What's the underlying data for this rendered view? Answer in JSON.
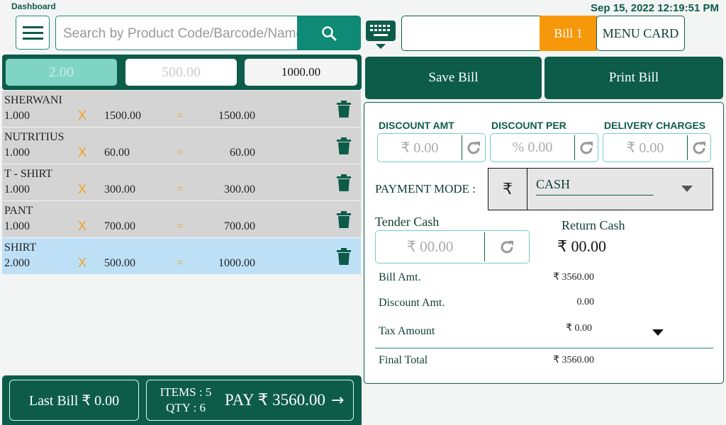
{
  "header": {
    "title": "Dashboard",
    "datetime": "Sep 15, 2022 12:19:51 PM",
    "search_placeholder": "Search by Product Code/Barcode/Name",
    "bill_tab": "Bill 1",
    "menu_card": "MENU CARD"
  },
  "quick_values": [
    "2.00",
    "500.00",
    "1000.00"
  ],
  "items": [
    {
      "name": "SHERWANI",
      "qty": "1.000",
      "price": "1500.00",
      "total": "1500.00",
      "selected": false
    },
    {
      "name": "NUTRITIUS",
      "qty": "1.000",
      "price": "60.00",
      "total": "60.00",
      "selected": false
    },
    {
      "name": "T - SHIRT",
      "qty": "1.000",
      "price": "300.00",
      "total": "300.00",
      "selected": false
    },
    {
      "name": "PANT",
      "qty": "1.000",
      "price": "700.00",
      "total": "700.00",
      "selected": false
    },
    {
      "name": "SHIRT",
      "qty": "2.000",
      "price": "500.00",
      "total": "1000.00",
      "selected": true
    }
  ],
  "symbols": {
    "times": "X",
    "equals": "="
  },
  "footer": {
    "last_bill": "Last Bill ₹ 0.00",
    "items": "ITEMS : 5",
    "qty": "QTY : 6",
    "pay": "PAY ₹ 3560.00",
    "arrow": "→"
  },
  "actions": {
    "save": "Save Bill",
    "print": "Print Bill"
  },
  "discount": {
    "amt_label": "DISCOUNT AMT",
    "amt_placeholder": "₹ 0.00",
    "per_label": "DISCOUNT PER",
    "per_placeholder": "% 0.00",
    "delivery_label": "DELIVERY CHARGES",
    "delivery_placeholder": "₹ 0.00"
  },
  "payment": {
    "label": "PAYMENT MODE :",
    "currency": "₹",
    "mode": "CASH"
  },
  "tender": {
    "label": "Tender Cash",
    "placeholder": "₹ 00.00",
    "return_label": "Return Cash",
    "return_value": "₹ 00.00"
  },
  "summary": {
    "bill_label": "Bill Amt.",
    "bill_value": "₹ 3560.00",
    "disc_label": "Discount Amt.",
    "disc_value": "0.00",
    "tax_label": "Tax Amount",
    "tax_value": "₹ 0.00",
    "final_label": "Final Total",
    "final_value": "₹ 3560.00"
  },
  "colors": {
    "primary": "#0d5c4a",
    "accent": "#f7980a",
    "teal": "#0e8a76",
    "selected_row": "#bde0f7"
  }
}
